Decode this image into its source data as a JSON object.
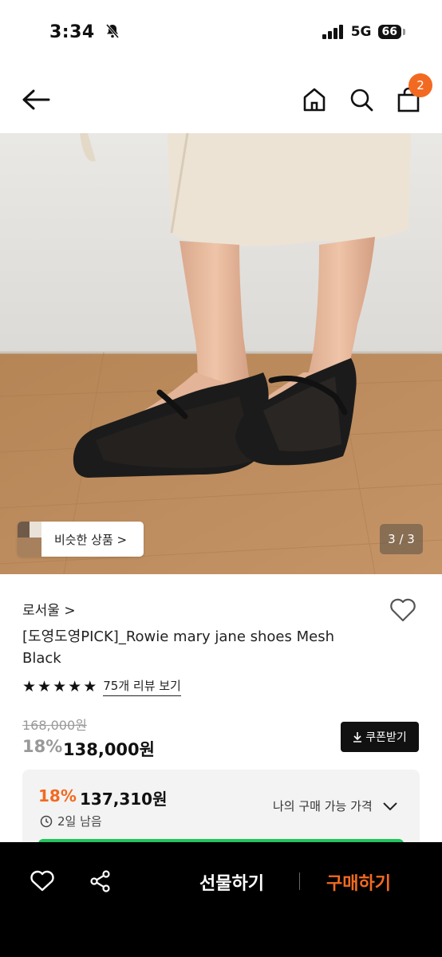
{
  "status_bar": {
    "time": "3:34",
    "network": "5G",
    "battery": "66"
  },
  "header": {
    "cart_count": "2"
  },
  "product_image": {
    "similar_label": "비슷한 상품 >",
    "counter": "3 / 3"
  },
  "product": {
    "brand": "로서울 >",
    "title": "[도영도영PICK]_Rowie mary jane shoes Mesh Black",
    "rating_stars": 5,
    "review_link": "75개 리뷰 보기",
    "original_price": "168,000원",
    "discount": "18%",
    "price": "138,000원",
    "coupon_label": "쿠폰받기"
  },
  "best_price": {
    "discount": "18%",
    "price": "137,310원",
    "days_left": "2일 남음",
    "my_price_label": "나의 구매 가능 가격"
  },
  "bottom_bar": {
    "gift_label": "선물하기",
    "buy_label": "구매하기"
  },
  "colors": {
    "accent": "#f26a21",
    "green": "#22c55e"
  }
}
